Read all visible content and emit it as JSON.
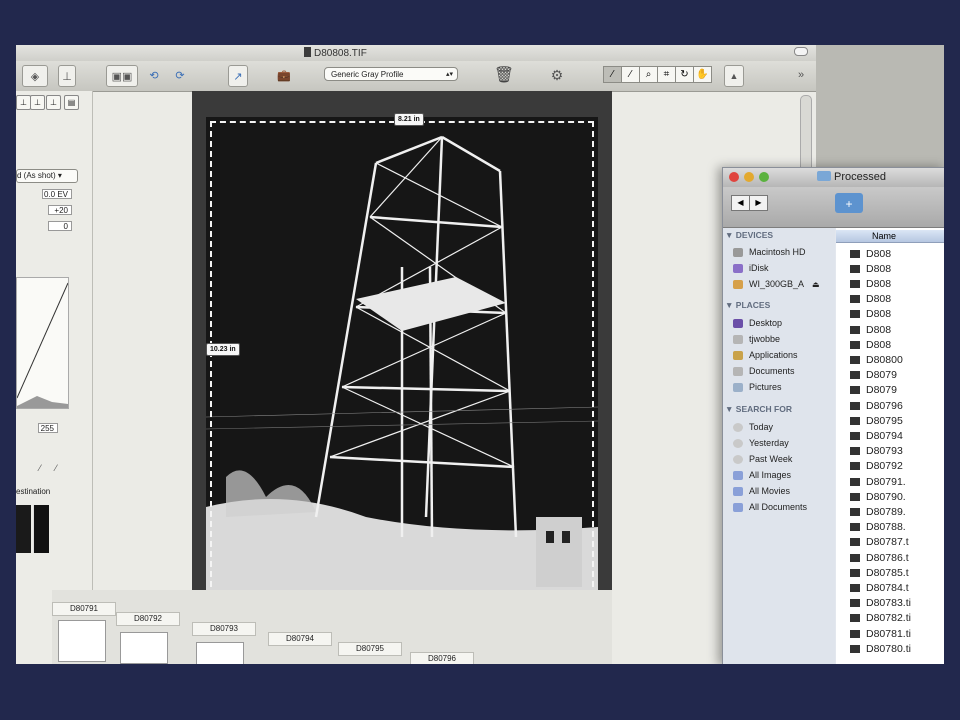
{
  "editor": {
    "title": "D80808.TIF",
    "profile": "Generic Gray Profile",
    "palette": {
      "dropdown": "d (As shot)",
      "exposure": "0.0 EV",
      "val1": "+20",
      "val2": "0",
      "level": "255",
      "destination": "estination"
    },
    "width_label": "8.21 in",
    "height_label": "10.23 in",
    "filmstrip": [
      "D80791",
      "D80792",
      "D80793",
      "D80794",
      "D80795",
      "D80796"
    ]
  },
  "finder": {
    "title": "Processed",
    "column_header": "Name",
    "devices_header": "DEVICES",
    "devices": [
      "Macintosh HD",
      "iDisk",
      "WI_300GB_A"
    ],
    "places_header": "PLACES",
    "places": [
      "Desktop",
      "tjwobbe",
      "Applications",
      "Documents",
      "Pictures"
    ],
    "search_header": "SEARCH FOR",
    "searches": [
      "Today",
      "Yesterday",
      "Past Week",
      "All Images",
      "All Movies",
      "All Documents"
    ],
    "files": [
      "D808",
      "D808",
      "D808",
      "D808",
      "D808",
      "D808",
      "D808",
      "D80800",
      "D8079",
      "D8079",
      "D80796",
      "D80795",
      "D80794",
      "D80793",
      "D80792",
      "D80791.",
      "D80790.",
      "D80789.",
      "D80788.",
      "D80787.t",
      "D80786.t",
      "D80785.t",
      "D80784.t",
      "D80783.ti",
      "D80782.ti",
      "D80781.ti",
      "D80780.ti"
    ]
  }
}
